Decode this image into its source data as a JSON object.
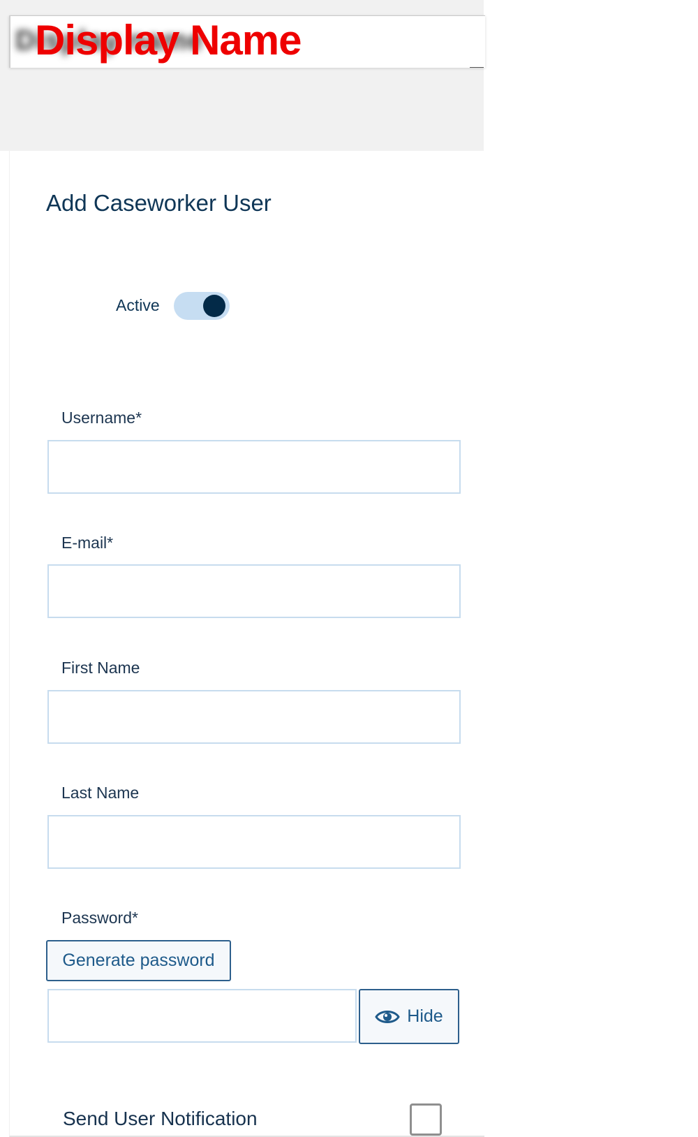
{
  "header": {
    "blurred_text": "Display name",
    "overlay_label": "Display Name"
  },
  "form": {
    "title": "Add Caseworker User",
    "active": {
      "label": "Active",
      "on": true
    },
    "username": {
      "label": "Username*",
      "value": ""
    },
    "email": {
      "label": "E-mail*",
      "value": ""
    },
    "first_name": {
      "label": "First Name",
      "value": ""
    },
    "last_name": {
      "label": "Last Name",
      "value": ""
    },
    "password": {
      "label": "Password*",
      "generate_label": "Generate password",
      "value": "",
      "toggle_label": "Hide",
      "toggle_icon": "eye-icon"
    },
    "notification": {
      "label": "Send User Notification",
      "checked": false
    }
  },
  "colors": {
    "primary_dark": "#032a48",
    "toggle_track": "#c6ddf2",
    "button_text": "#1e5a8a",
    "overlay_red": "#ee0000"
  }
}
